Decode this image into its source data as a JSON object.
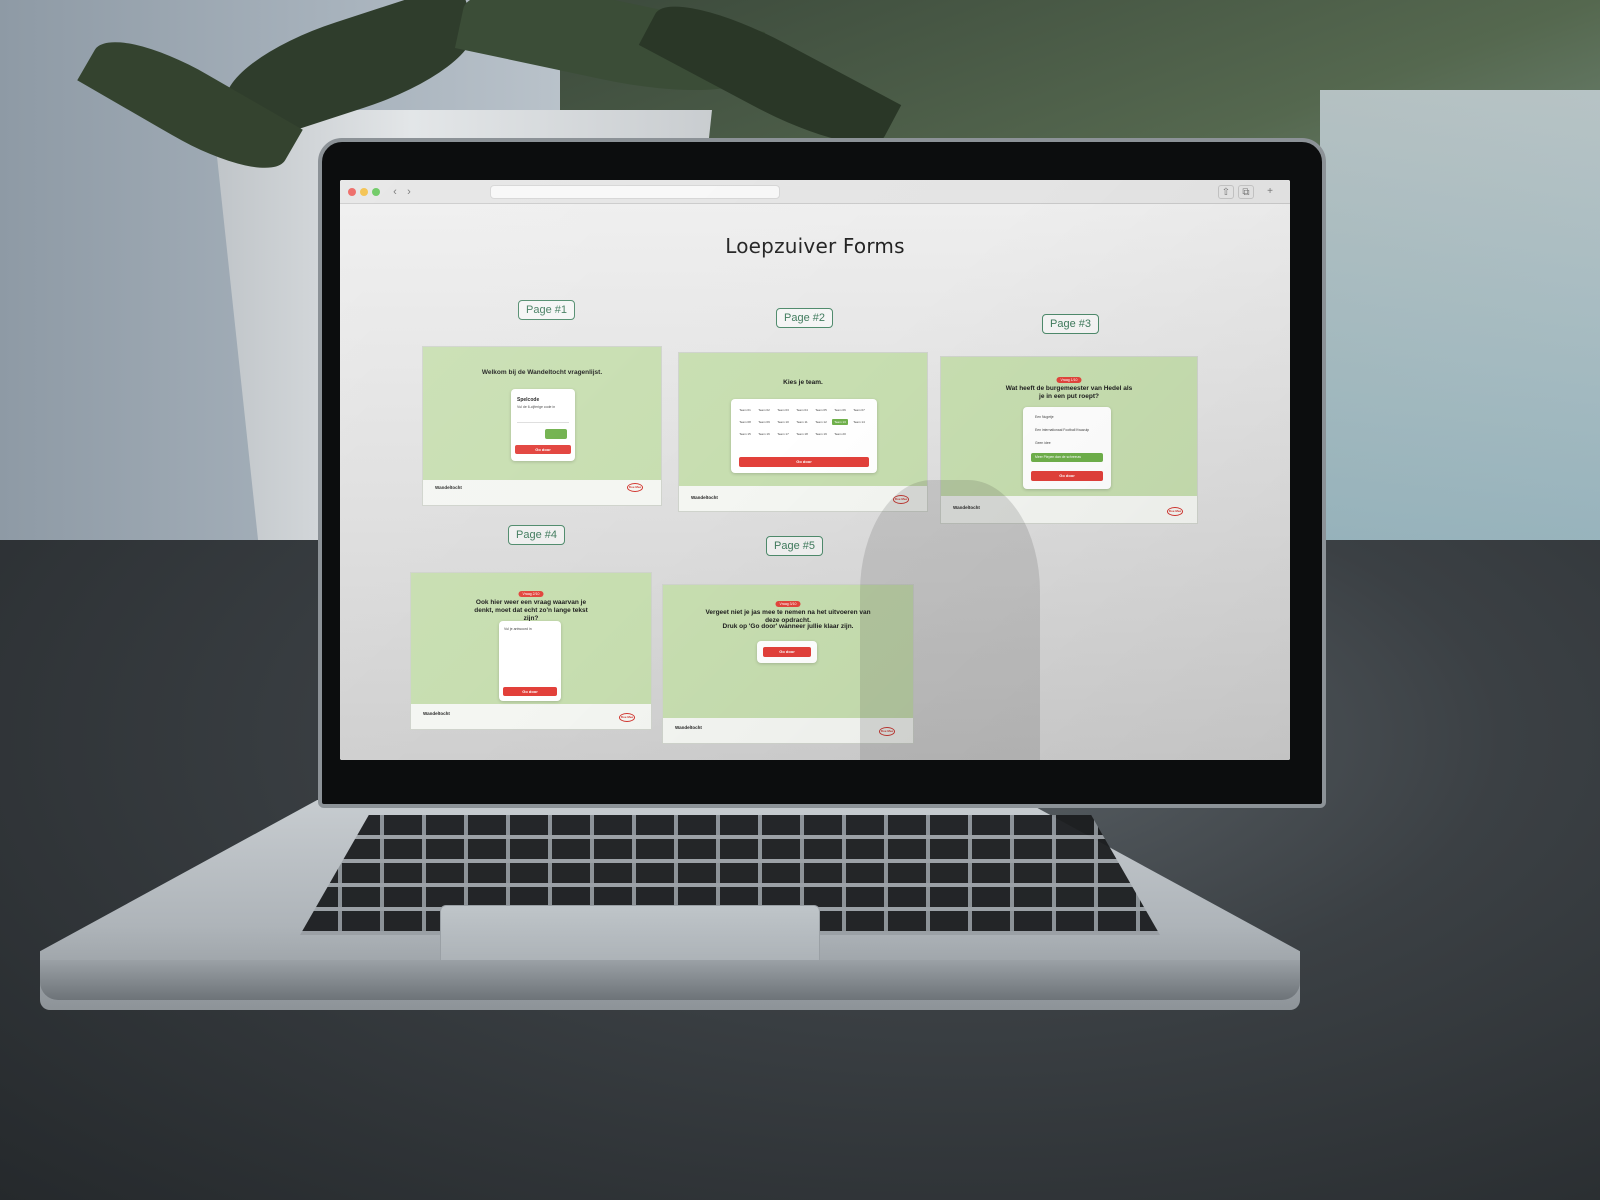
{
  "screen": {
    "page_title": "Loepzuiver Forms",
    "pages": [
      {
        "tag": "Page #1"
      },
      {
        "tag": "Page #2"
      },
      {
        "tag": "Page #3"
      },
      {
        "tag": "Page #4"
      },
      {
        "tag": "Page #5"
      }
    ],
    "frames": {
      "p1": {
        "heading": "Welkom bij de Wandeltocht vragenlijst.",
        "card_title": "Spelcode",
        "card_sub": "Vul de 6-cijferige code in",
        "btn": "Go door",
        "footer": "Wandeltocht"
      },
      "p2": {
        "heading": "Kies je team.",
        "btn": "Go door",
        "footer": "Wandeltocht",
        "teams": [
          "Team 01",
          "Team 02",
          "Team 03",
          "Team 04",
          "Team 05",
          "Team 06",
          "Team 07",
          "Team 08",
          "Team 09",
          "Team 10",
          "Team 11",
          "Team 12",
          "Team 13",
          "Team 14",
          "Team 15",
          "Team 16",
          "Team 17",
          "Team 18",
          "Team 19",
          "Team 20"
        ],
        "selected": "Team 13"
      },
      "p3": {
        "badge": "Vraag 1/10",
        "heading": "Wat heeft de burgemeester van Hedel als je in een put roept?",
        "btn": "Go door",
        "footer": "Wandeltocht",
        "options": [
          "Een Nugetje",
          "Een internationaal Football Kwazulp",
          "Geen idee"
        ],
        "selected_option": "Meer Piepen dan de schreeuw"
      },
      "p4": {
        "badge": "Vraag 2/10",
        "heading": "Ook hier weer een vraag waarvan je denkt, moet dat echt zo'n lange tekst zijn?",
        "placeholder": "Vul je antwoord in",
        "btn": "Go door",
        "footer": "Wandeltocht"
      },
      "p5": {
        "badge": "Vraag 3/10",
        "heading": "Vergeet niet je jas mee te nemen na het uitvoeren van deze opdracht.",
        "sub": "Druk op 'Go door' wanneer jullie klaar zijn.",
        "btn": "Go door",
        "footer": "Wandeltocht"
      }
    },
    "logo_text": "Doe Mee",
    "colors": {
      "accent_green": "#4e8a6b",
      "form_green": "#c7deb0",
      "select_green": "#6fb04b",
      "button_red": "#e2403a"
    }
  },
  "icons": {
    "back": "chevron-left-icon",
    "forward": "chevron-right-icon",
    "share": "share-icon",
    "tabs": "tabs-icon",
    "plus": "plus-icon"
  }
}
